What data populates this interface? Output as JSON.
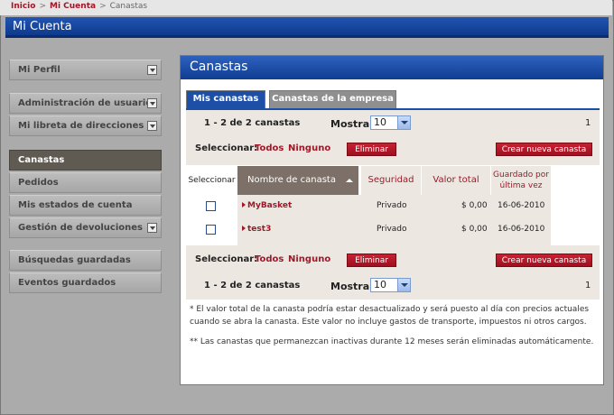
{
  "breadcrumb": {
    "home": "Inicio",
    "account": "Mi Cuenta",
    "current": "Canastas",
    "sep": ">"
  },
  "header": {
    "title": "Mi Cuenta"
  },
  "sidebar": {
    "profile": "Mi Perfil",
    "users": "Administración de usuarios",
    "addresses": "Mi libreta de direcciones",
    "baskets": "Canastas",
    "orders": "Pedidos",
    "statements": "Mis estados de cuenta",
    "returns": "Gestión de devoluciones",
    "searches": "Búsquedas guardadas",
    "events": "Eventos guardados"
  },
  "panel": {
    "title": "Canastas",
    "tabs": {
      "mine": "Mis canastas",
      "company": "Canastas de la empresa"
    }
  },
  "paging": {
    "range": "1 - 2 de 2 canastas",
    "show_label": "Mostrar",
    "show_value": "10",
    "page": "1"
  },
  "actions": {
    "select_label": "Seleccionar:",
    "all": "Todos",
    "none": "Ninguno",
    "delete": "Eliminar",
    "create": "Crear nueva canasta"
  },
  "table": {
    "headers": {
      "select": "Seleccionar",
      "name": "Nombre de canasta",
      "security": "Seguridad",
      "total": "Valor total",
      "saved": "Guardado por última vez"
    },
    "rows": [
      {
        "name": "MyBasket",
        "security": "Privado",
        "total": "$ 0,00",
        "saved": "16-06-2010"
      },
      {
        "name": "test3",
        "security": "Privado",
        "total": "$ 0,00",
        "saved": "16-06-2010"
      }
    ]
  },
  "notes": {
    "n1": "* El valor total de la canasta podría estar desactualizado y será puesto al día con precios actuales cuando se abra la canasta. Este valor no incluye gastos de transporte, impuestos ni otros cargos.",
    "n2": "** Las canastas que permanezcan inactivas durante 12 meses serán eliminadas automáticamente."
  },
  "colors": {
    "brand_blue": "#1d4fa6",
    "brand_red": "#a01828",
    "sort_header": "#7d7068"
  }
}
